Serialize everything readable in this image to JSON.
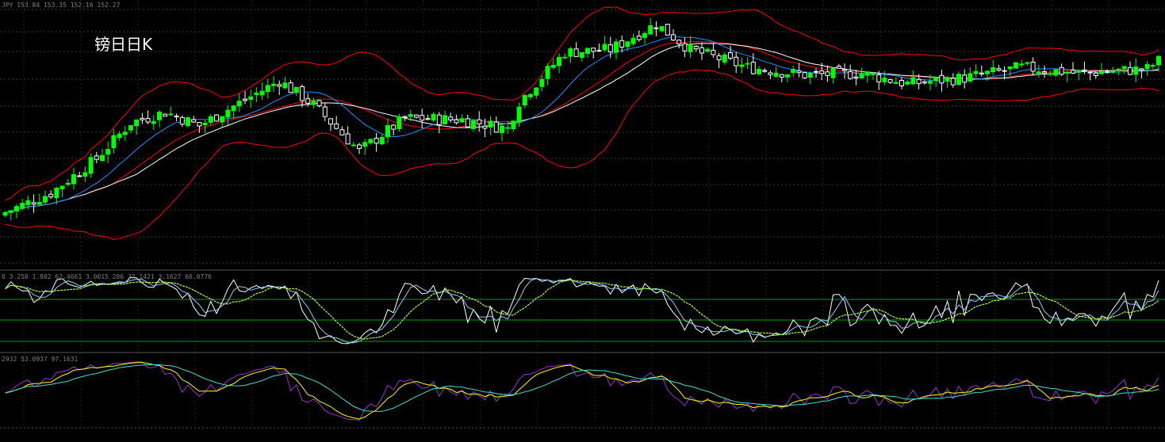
{
  "title": "镑日日K",
  "headers": {
    "price": "JPY  153.84 153.35 152.16 152.27",
    "macd": "0  3.250  1.802  62.4661  3.0015  286  27.1421  3.1627  66.0776",
    "rsi": "2932  53.0937  97.1631"
  },
  "colors": {
    "background": "#000000",
    "bull": "#00ff00",
    "bear": "#ffffff",
    "bollinger": "#ff0000",
    "ma_slow": "#ffffff",
    "ma_fast": "#1e90ff",
    "grid": "#3a3a3a",
    "level": "#00a000",
    "osc_main": "#ffffff",
    "osc_signal": "#87cefa",
    "osc_slow": "#adff2f",
    "rsi": "#9932cc",
    "rsi_fast": "#ffff00",
    "rsi_slow": "#40e0d0"
  },
  "chart_data": {
    "type": "candlestick",
    "symbol": "GBPJPY",
    "timeframe": "D1",
    "bars": 130,
    "price_anchors": [
      [
        0,
        152.2
      ],
      [
        8,
        153.5
      ],
      [
        16,
        155.8
      ],
      [
        22,
        158.2
      ],
      [
        28,
        158.9
      ],
      [
        34,
        158.0
      ],
      [
        40,
        159.3
      ],
      [
        48,
        161.0
      ],
      [
        54,
        159.4
      ],
      [
        62,
        156.3
      ],
      [
        70,
        158.5
      ],
      [
        80,
        158.4
      ],
      [
        88,
        157.8
      ],
      [
        90,
        159.6
      ],
      [
        98,
        162.9
      ],
      [
        106,
        163.1
      ],
      [
        114,
        164.8
      ],
      [
        120,
        163.1
      ],
      [
        130,
        161.9
      ],
      [
        140,
        161.4
      ],
      [
        150,
        161.5
      ],
      [
        158,
        160.8
      ],
      [
        168,
        161.2
      ],
      [
        178,
        161.9
      ],
      [
        188,
        161.5
      ],
      [
        200,
        161.8
      ],
      [
        203,
        162.6
      ]
    ],
    "last_close": 152.27,
    "indicators": [
      "Bollinger Bands",
      "Moving Average (2)",
      "Stochastic",
      "RSI"
    ],
    "oscillator_levels": [
      80,
      50,
      20
    ],
    "grid": true
  }
}
